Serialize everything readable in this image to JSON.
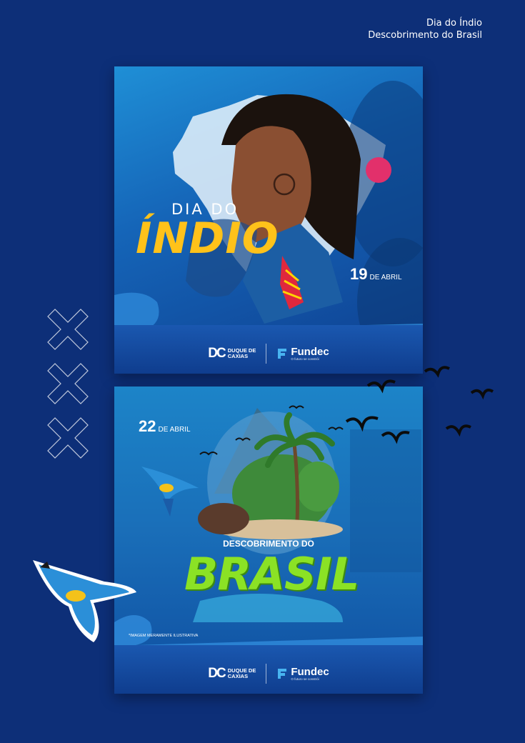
{
  "header": {
    "line1": "Dia do Índio",
    "line2": "Descobrimento do Brasil"
  },
  "card1": {
    "title_small": "DIA DO",
    "title_big": "ÍNDIO",
    "date_number": "19",
    "date_month": "DE ABRIL"
  },
  "card2": {
    "date_number": "22",
    "date_month": "DE ABRIL",
    "subtitle": "DESCOBRIMENTO DO",
    "title_big": "BRASIL",
    "disclaimer": "*IMAGEM MERAMENTE ILUSTRATIVA"
  },
  "logos": {
    "dc_mark": "DC",
    "dc_line1": "DUQUE DE",
    "dc_line2": "CAXIAS",
    "fundec_name": "Fundec",
    "fundec_tagline": "O futuro se constrói"
  },
  "colors": {
    "background": "#0d2f78",
    "indio_yellow": "#ffc21a",
    "brasil_green": "#8be225"
  }
}
